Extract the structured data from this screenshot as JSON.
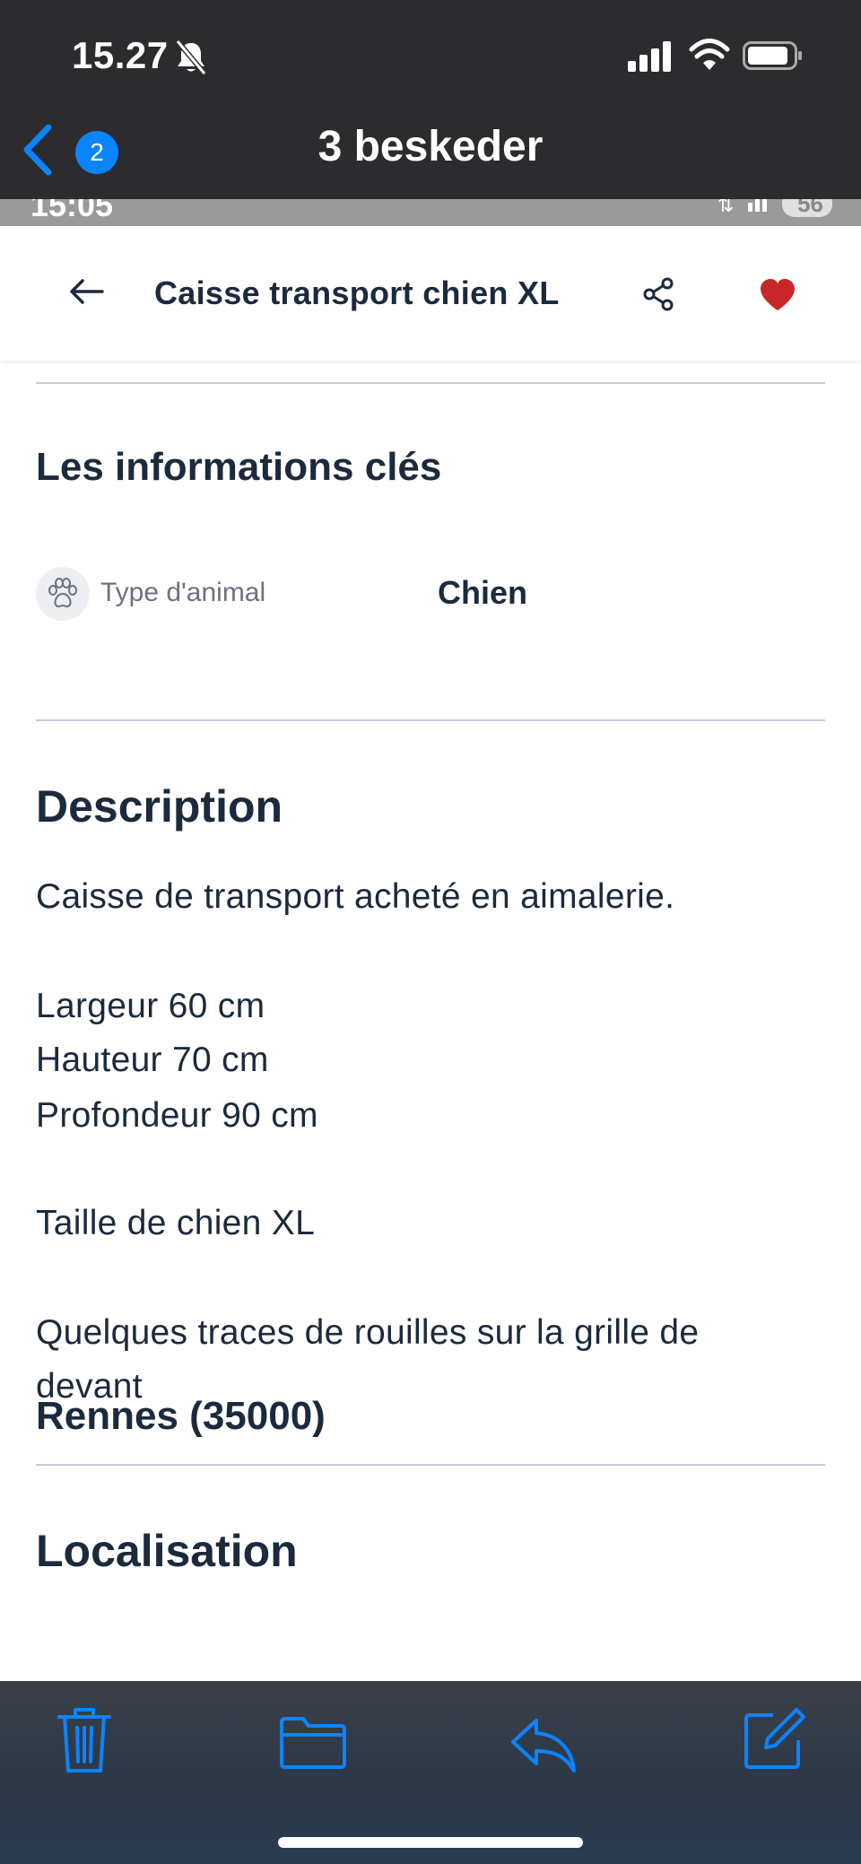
{
  "status_bar": {
    "time": "15.27"
  },
  "mail_nav": {
    "unread_count": "2",
    "title": "3 beskeder"
  },
  "screenshot_strip": {
    "time": "15:05",
    "battery": "56"
  },
  "app_header": {
    "title": "Caisse transport chien XL"
  },
  "key_info": {
    "heading": "Les informations clés",
    "attribute_label": "Type d'animal",
    "attribute_value": "Chien"
  },
  "description": {
    "heading": "Description",
    "lines": [
      "Caisse de transport acheté en aimalerie.",
      "Largeur 60 cm",
      "Hauteur 70 cm",
      "Profondeur 90 cm",
      "Taille de chien XL",
      "Quelques traces de rouilles sur la grille de",
      "devant"
    ]
  },
  "location": {
    "heading": "Localisation",
    "city": "Rennes (35000)"
  },
  "toolbar": {
    "icons": [
      "trash-icon",
      "folder-icon",
      "reply-icon",
      "compose-icon"
    ]
  },
  "colors": {
    "ios_accent": "#0a84ff",
    "heart": "#c62828",
    "text_dark": "#1b2a3d"
  }
}
